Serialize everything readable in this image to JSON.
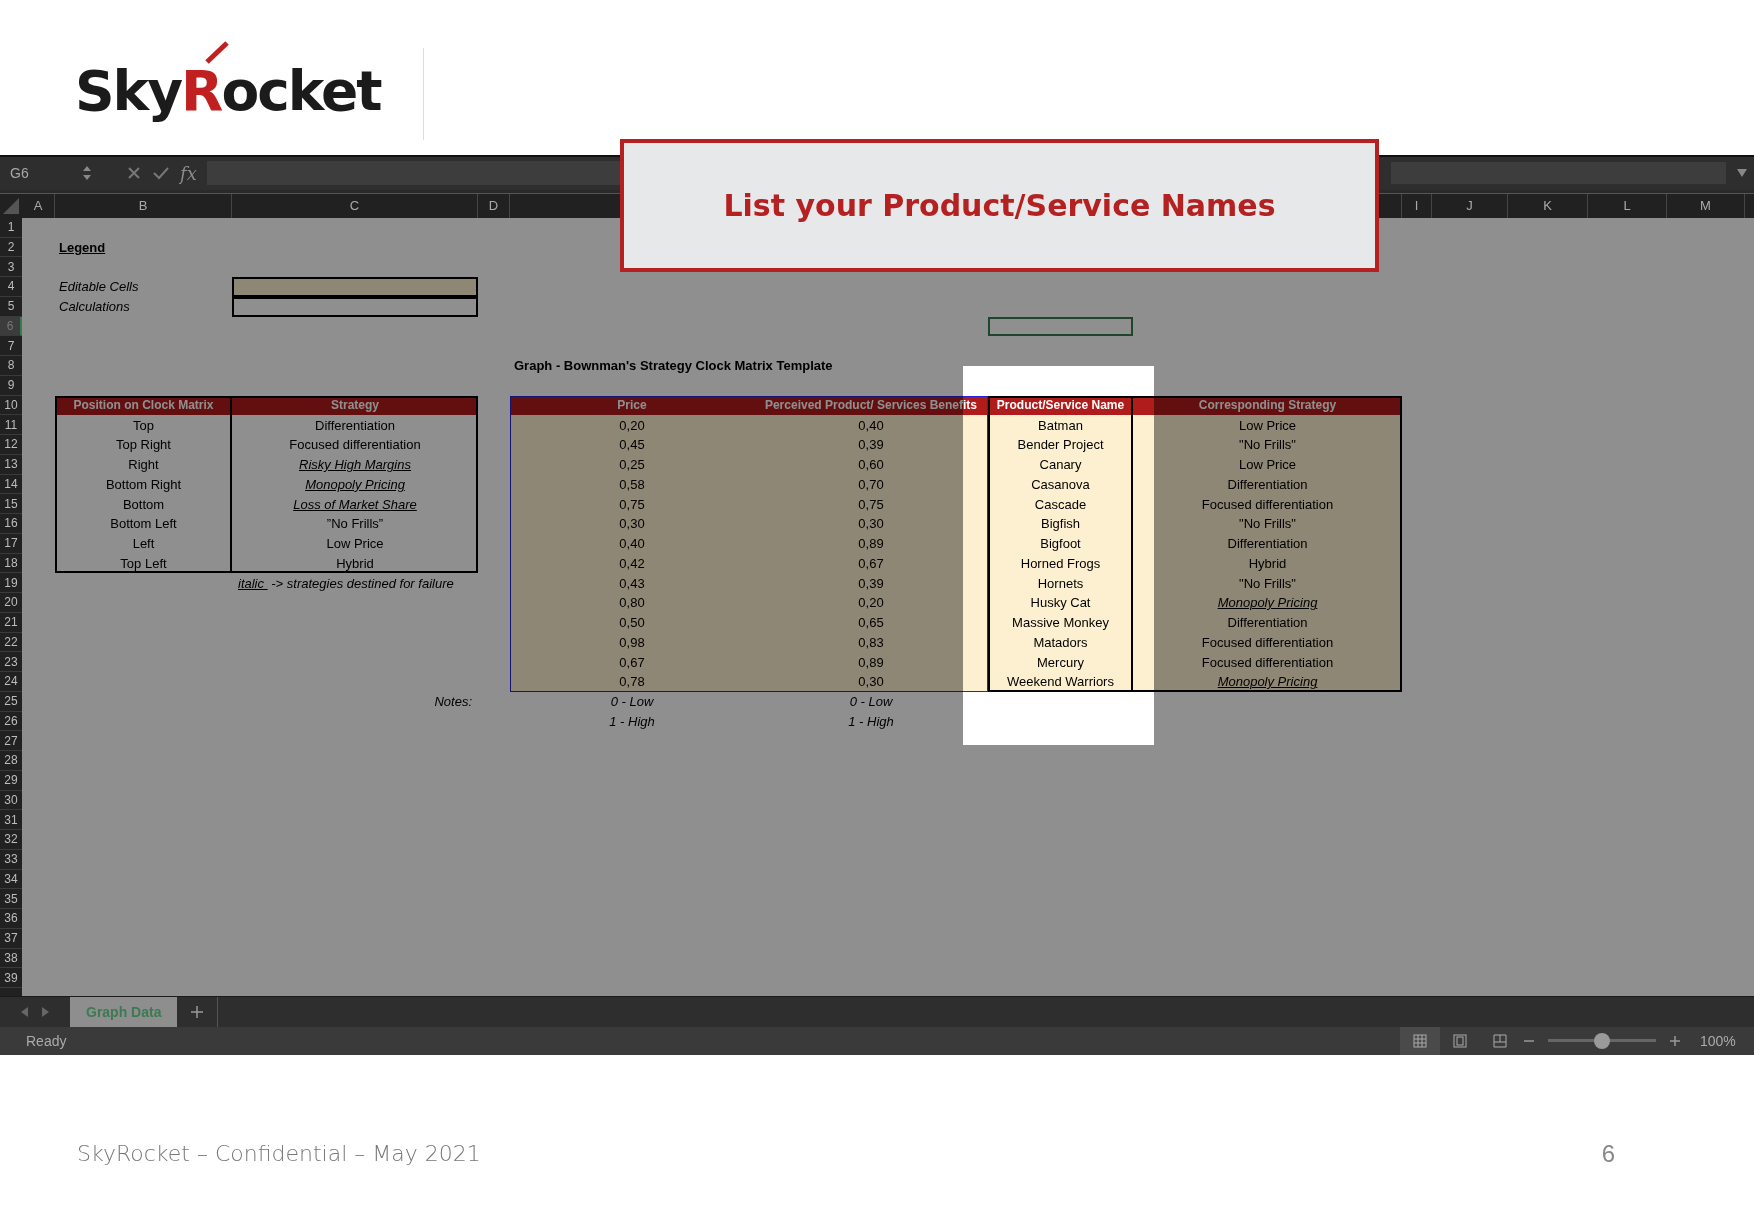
{
  "logo": {
    "parts": [
      {
        "text": "Sky",
        "accent": false
      },
      {
        "text": "R",
        "accent": true
      },
      {
        "text": "ocket",
        "accent": false
      }
    ]
  },
  "callout": {
    "text": "List your Product/Service Names"
  },
  "formula_bar": {
    "name_box": "G6",
    "function_label": "fx"
  },
  "column_headers": [
    "A",
    "B",
    "C",
    "D",
    "I",
    "J",
    "K",
    "L",
    "M"
  ],
  "row_headers": [
    {
      "label": "1",
      "selected": false
    },
    {
      "label": "2",
      "selected": false
    },
    {
      "label": "3",
      "selected": false
    },
    {
      "label": "4",
      "selected": false
    },
    {
      "label": "5",
      "selected": false
    },
    {
      "label": "6",
      "selected": true
    },
    {
      "label": "7",
      "selected": false
    },
    {
      "label": "8",
      "selected": false
    },
    {
      "label": "9",
      "selected": false
    },
    {
      "label": "10",
      "selected": false
    },
    {
      "label": "11",
      "selected": false
    },
    {
      "label": "12",
      "selected": false
    },
    {
      "label": "13",
      "selected": false
    },
    {
      "label": "14",
      "selected": false
    },
    {
      "label": "15",
      "selected": false
    },
    {
      "label": "16",
      "selected": false
    },
    {
      "label": "17",
      "selected": false
    },
    {
      "label": "18",
      "selected": false
    },
    {
      "label": "19",
      "selected": false
    },
    {
      "label": "20",
      "selected": false
    },
    {
      "label": "21",
      "selected": false
    },
    {
      "label": "22",
      "selected": false
    },
    {
      "label": "23",
      "selected": false
    },
    {
      "label": "24",
      "selected": false
    },
    {
      "label": "25",
      "selected": false
    },
    {
      "label": "26",
      "selected": false
    },
    {
      "label": "27",
      "selected": false
    },
    {
      "label": "28",
      "selected": false
    },
    {
      "label": "29",
      "selected": false
    },
    {
      "label": "30",
      "selected": false
    },
    {
      "label": "31",
      "selected": false
    },
    {
      "label": "32",
      "selected": false
    },
    {
      "label": "33",
      "selected": false
    },
    {
      "label": "34",
      "selected": false
    },
    {
      "label": "35",
      "selected": false
    },
    {
      "label": "36",
      "selected": false
    },
    {
      "label": "37",
      "selected": false
    },
    {
      "label": "38",
      "selected": false
    },
    {
      "label": "39",
      "selected": false
    }
  ],
  "legend": {
    "title": "Legend",
    "items": [
      {
        "label": "Editable Cells",
        "kind": "editable"
      },
      {
        "label": "Calculations",
        "kind": "calculation"
      }
    ]
  },
  "matrix_table": {
    "columns": [
      "Position on Clock Matrix",
      "Strategy"
    ],
    "rows": [
      {
        "position": "Top",
        "strategy": "Differentiation",
        "failure": false
      },
      {
        "position": "Top Right",
        "strategy": "Focused differentiation",
        "failure": false
      },
      {
        "position": "Right",
        "strategy": "Risky High Margins",
        "failure": true
      },
      {
        "position": "Bottom Right",
        "strategy": "Monopoly Pricing",
        "failure": true
      },
      {
        "position": "Bottom",
        "strategy": "Loss of Market Share",
        "failure": true
      },
      {
        "position": "Bottom Left",
        "strategy": "”No Frills”",
        "failure": false
      },
      {
        "position": "Left",
        "strategy": "Low Price",
        "failure": false
      },
      {
        "position": "Top Left",
        "strategy": "Hybrid",
        "failure": false
      }
    ],
    "note": {
      "marker": "italic ",
      "text": "-> strategies destined for failure"
    }
  },
  "graph_title": "Graph - Bownman's Strategy Clock Matrix Template",
  "graph_table": {
    "columns": [
      "Price",
      "Perceived Product/ Services Benefits",
      "Product/Service Name",
      "Corresponding Strategy"
    ],
    "rows": [
      {
        "price": "0,20",
        "benefits": "0,40",
        "name": "Batman",
        "strategy": "Low Price",
        "failure": false
      },
      {
        "price": "0,45",
        "benefits": "0,39",
        "name": "Bender Project",
        "strategy": "\"No Frills\"",
        "failure": false
      },
      {
        "price": "0,25",
        "benefits": "0,60",
        "name": "Canary",
        "strategy": "Low Price",
        "failure": false
      },
      {
        "price": "0,58",
        "benefits": "0,70",
        "name": "Casanova",
        "strategy": "Differentiation",
        "failure": false
      },
      {
        "price": "0,75",
        "benefits": "0,75",
        "name": "Cascade",
        "strategy": "Focused differentiation",
        "failure": false
      },
      {
        "price": "0,30",
        "benefits": "0,30",
        "name": "Bigfish",
        "strategy": "\"No Frills\"",
        "failure": false
      },
      {
        "price": "0,40",
        "benefits": "0,89",
        "name": "Bigfoot",
        "strategy": "Differentiation",
        "failure": false
      },
      {
        "price": "0,42",
        "benefits": "0,67",
        "name": "Horned Frogs",
        "strategy": "Hybrid",
        "failure": false
      },
      {
        "price": "0,43",
        "benefits": "0,39",
        "name": "Hornets",
        "strategy": "\"No Frills\"",
        "failure": false
      },
      {
        "price": "0,80",
        "benefits": "0,20",
        "name": "Husky Cat",
        "strategy": "Monopoly Pricing",
        "failure": true
      },
      {
        "price": "0,50",
        "benefits": "0,65",
        "name": "Massive Monkey",
        "strategy": "Differentiation",
        "failure": false
      },
      {
        "price": "0,98",
        "benefits": "0,83",
        "name": "Matadors",
        "strategy": "Focused differentiation",
        "failure": false
      },
      {
        "price": "0,67",
        "benefits": "0,89",
        "name": "Mercury",
        "strategy": "Focused differentiation",
        "failure": false
      },
      {
        "price": "0,78",
        "benefits": "0,30",
        "name": "Weekend Warriors",
        "strategy": "Monopoly Pricing",
        "failure": true
      }
    ]
  },
  "notes": {
    "label": "Notes:",
    "rows": [
      {
        "price": "0 - Low",
        "benefits": "0 - Low"
      },
      {
        "price": "1 - High",
        "benefits": "1 - High"
      }
    ]
  },
  "sheet_tabs": [
    {
      "label": "Graph Data",
      "selected": true
    }
  ],
  "status_bar": {
    "status": "Ready",
    "views": [
      {
        "kind": "normal",
        "selected": true
      },
      {
        "kind": "page-layout",
        "selected": false
      },
      {
        "kind": "page-break",
        "selected": false
      }
    ],
    "zoom": {
      "level": 0.5,
      "reading": "100%"
    }
  },
  "footer": {
    "text": "SkyRocket – Confidential – May 2021",
    "page": "6"
  }
}
